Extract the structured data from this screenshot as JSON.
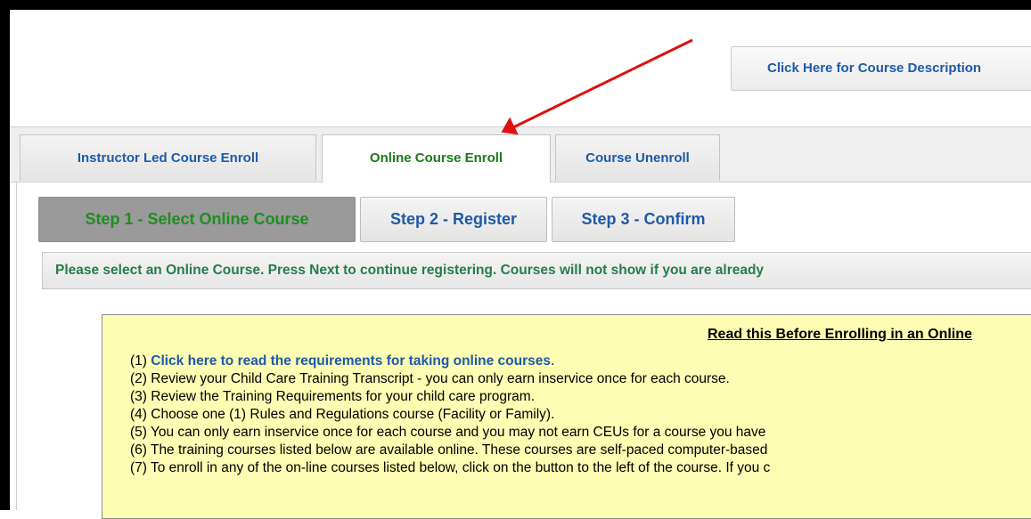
{
  "header": {
    "course_description_button": "Click Here for Course Description"
  },
  "tabs": [
    {
      "label": "Instructor Led Course Enroll",
      "active": false
    },
    {
      "label": "Online Course Enroll",
      "active": true
    },
    {
      "label": "Course Unenroll",
      "active": false
    }
  ],
  "steps": [
    {
      "label": "Step 1 - Select Online Course",
      "active": true
    },
    {
      "label": "Step 2 - Register",
      "active": false
    },
    {
      "label": "Step 3 - Confirm",
      "active": false
    }
  ],
  "instruction": "Please select an Online Course. Press Next to continue registering. Courses will not show if you are already",
  "notice": {
    "heading": "Read this Before Enrolling in an Online",
    "items": [
      {
        "prefix": "(1) ",
        "link": "Click here to read the requirements for taking online courses",
        "text": "."
      },
      {
        "prefix": "",
        "text": "(2) Review your Child Care Training Transcript - you can only earn inservice once for each course."
      },
      {
        "prefix": "",
        "text": "(3) Review the Training Requirements for your child care program."
      },
      {
        "prefix": "",
        "text": "(4) Choose one (1) Rules and Regulations course (Facility or Family)."
      },
      {
        "prefix": "",
        "text": "(5) You can only earn inservice once for each course and you may not earn CEUs for a course you have"
      },
      {
        "prefix": "",
        "text": "(6) The training courses listed below are available online. These courses are self-paced computer-based"
      },
      {
        "prefix": "",
        "text": "(7) To enroll in any of the on-line courses listed below, click on the button to the left of the course. If you c"
      }
    ]
  },
  "colors": {
    "link_blue": "#1d5aa8",
    "active_green": "#1b7a1b",
    "notice_yellow": "#fdfdb4",
    "annotation_red": "#e01010"
  }
}
